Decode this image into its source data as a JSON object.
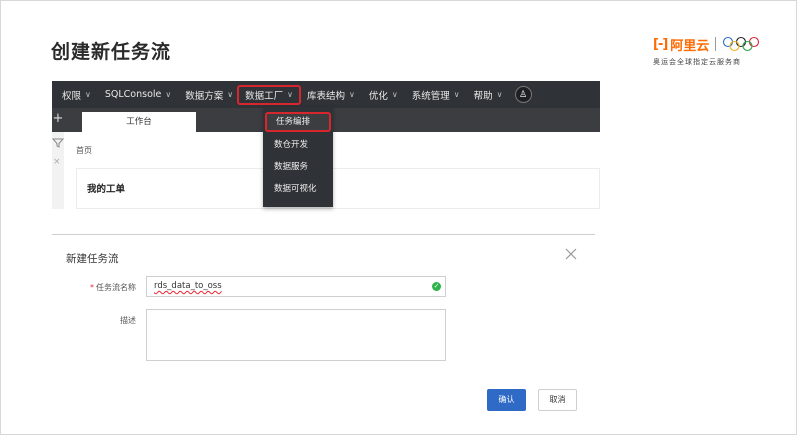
{
  "slide": {
    "title": "创建新任务流"
  },
  "brand": {
    "mark": "[-]",
    "name": "阿里云",
    "tagline": "奥运会全球指定云服务商"
  },
  "console": {
    "nav": [
      {
        "label": "权限",
        "chevron": "∨"
      },
      {
        "label": "SQLConsole",
        "chevron": "∨"
      },
      {
        "label": "数据方案",
        "chevron": "∨"
      },
      {
        "label": "数据工厂",
        "chevron": "∨",
        "active": true
      },
      {
        "label": "库表结构",
        "chevron": "∨"
      },
      {
        "label": "优化",
        "chevron": "∨"
      },
      {
        "label": "系统管理",
        "chevron": "∨"
      },
      {
        "label": "帮助",
        "chevron": "∨"
      }
    ],
    "avatar_glyph": "♙",
    "plus": "+",
    "tab_label": "工作台",
    "breadcrumb": "首页",
    "card_title": "我的工单",
    "close_glyph": "×",
    "dropdown": [
      {
        "label": "任务编排",
        "active": true
      },
      {
        "label": "数仓开发"
      },
      {
        "label": "数据服务"
      },
      {
        "label": "数据可视化"
      }
    ]
  },
  "dialog": {
    "title": "新建任务流",
    "name_label": "任务流名称",
    "required_mark": "*",
    "name_value": "rds_data_to_oss",
    "desc_label": "描述",
    "desc_value": "",
    "ok_mark": "✓",
    "ok_label": "确认",
    "cancel_label": "取消"
  },
  "colors": {
    "navbar": "#2f3236",
    "highlight": "#d7262e",
    "primary": "#2f6ac7",
    "brand": "#ff6a00",
    "success": "#2db34a"
  }
}
